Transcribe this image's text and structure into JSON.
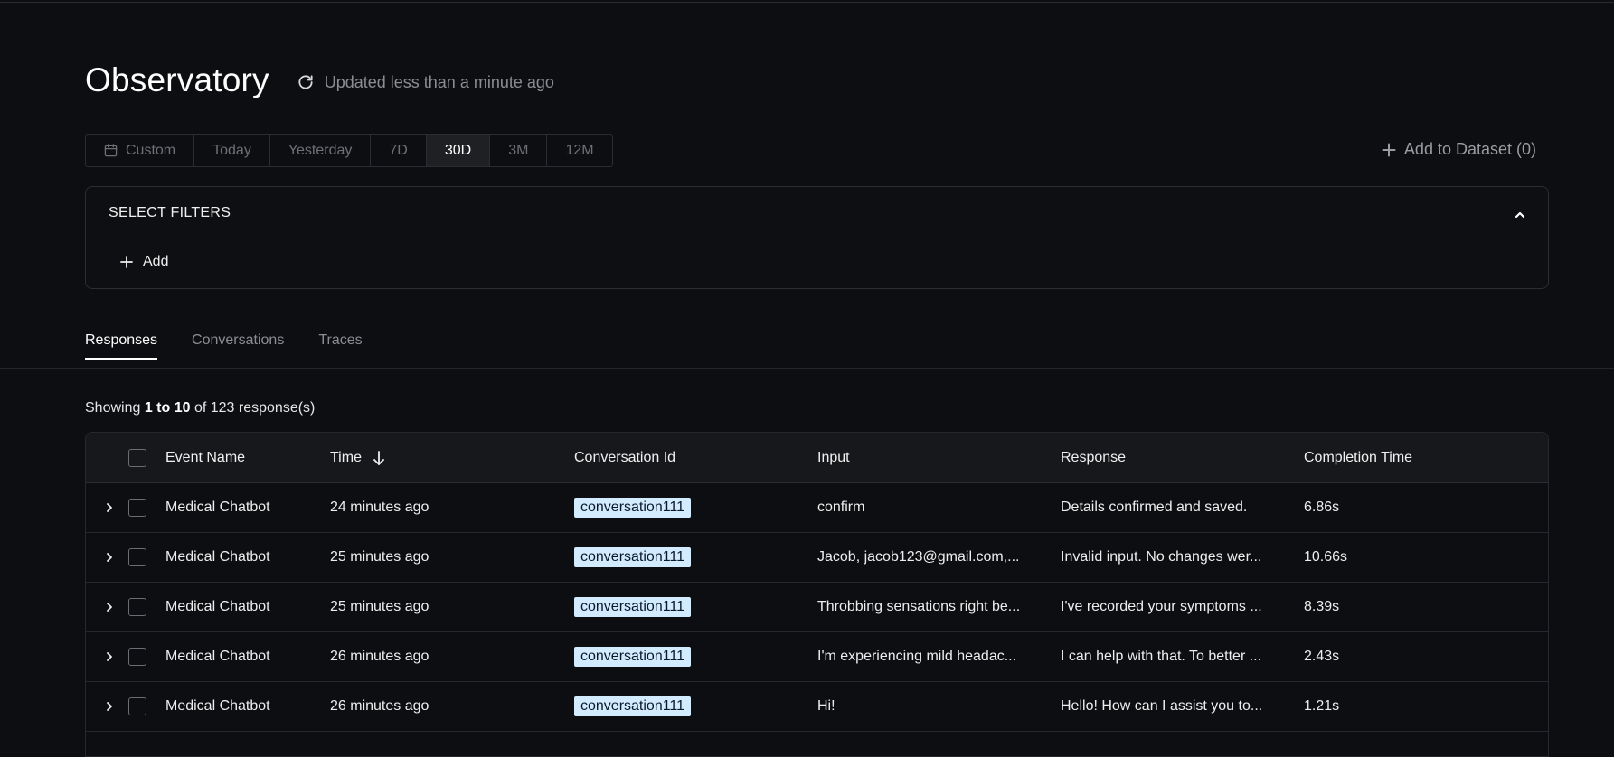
{
  "header": {
    "title": "Observatory",
    "updated_text": "Updated less than a minute ago"
  },
  "date_ranges": [
    {
      "label": "Custom",
      "icon": "calendar-icon"
    },
    {
      "label": "Today"
    },
    {
      "label": "Yesterday"
    },
    {
      "label": "7D"
    },
    {
      "label": "30D",
      "active": true
    },
    {
      "label": "3M"
    },
    {
      "label": "12M"
    }
  ],
  "add_dataset_label": "Add to Dataset (0)",
  "filters": {
    "title": "SELECT FILTERS",
    "add_label": "Add"
  },
  "tabs": [
    {
      "label": "Responses",
      "active": true
    },
    {
      "label": "Conversations"
    },
    {
      "label": "Traces"
    }
  ],
  "showing": {
    "prefix": "Showing",
    "range": "1 to 10",
    "suffix": "of 123 response(s)"
  },
  "table": {
    "columns": {
      "event_name": "Event Name",
      "time": "Time",
      "conversation_id": "Conversation Id",
      "input": "Input",
      "response": "Response",
      "completion_time": "Completion Time"
    },
    "rows": [
      {
        "event": "Medical Chatbot",
        "time": "24 minutes ago",
        "conversation": "conversation111",
        "input": "confirm",
        "response": "Details confirmed and saved.",
        "completion": "6.86s"
      },
      {
        "event": "Medical Chatbot",
        "time": "25 minutes ago",
        "conversation": "conversation111",
        "input": "Jacob, jacob123@gmail.com,...",
        "response": "Invalid input. No changes wer...",
        "completion": "10.66s"
      },
      {
        "event": "Medical Chatbot",
        "time": "25 minutes ago",
        "conversation": "conversation111",
        "input": "Throbbing sensations right be...",
        "response": "I've recorded your symptoms ...",
        "completion": "8.39s"
      },
      {
        "event": "Medical Chatbot",
        "time": "26 minutes ago",
        "conversation": "conversation111",
        "input": "I'm experiencing mild headac...",
        "response": "I can help with that. To better ...",
        "completion": "2.43s"
      },
      {
        "event": "Medical Chatbot",
        "time": "26 minutes ago",
        "conversation": "conversation111",
        "input": "Hi!",
        "response": "Hello! How can I assist you to...",
        "completion": "1.21s"
      }
    ]
  }
}
